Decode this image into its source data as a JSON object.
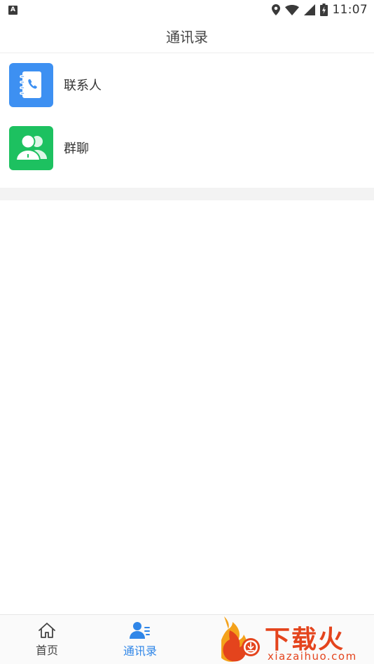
{
  "status_bar": {
    "badge": "A",
    "time": "11:07"
  },
  "header": {
    "title": "通讯录"
  },
  "list": {
    "items": [
      {
        "label": "联系人",
        "icon": "contact-book-icon",
        "color": "#3d90f2"
      },
      {
        "label": "群聊",
        "icon": "group-chat-icon",
        "color": "#1dc160"
      }
    ]
  },
  "bottom_nav": {
    "items": [
      {
        "label": "首页",
        "icon": "home-icon",
        "active": false
      },
      {
        "label": "通讯录",
        "icon": "contacts-icon",
        "active": true
      }
    ],
    "active_color": "#2f86e8"
  },
  "watermark": {
    "title": "下载火",
    "url": "xiazaihuo.com",
    "color": "#e4441d"
  }
}
